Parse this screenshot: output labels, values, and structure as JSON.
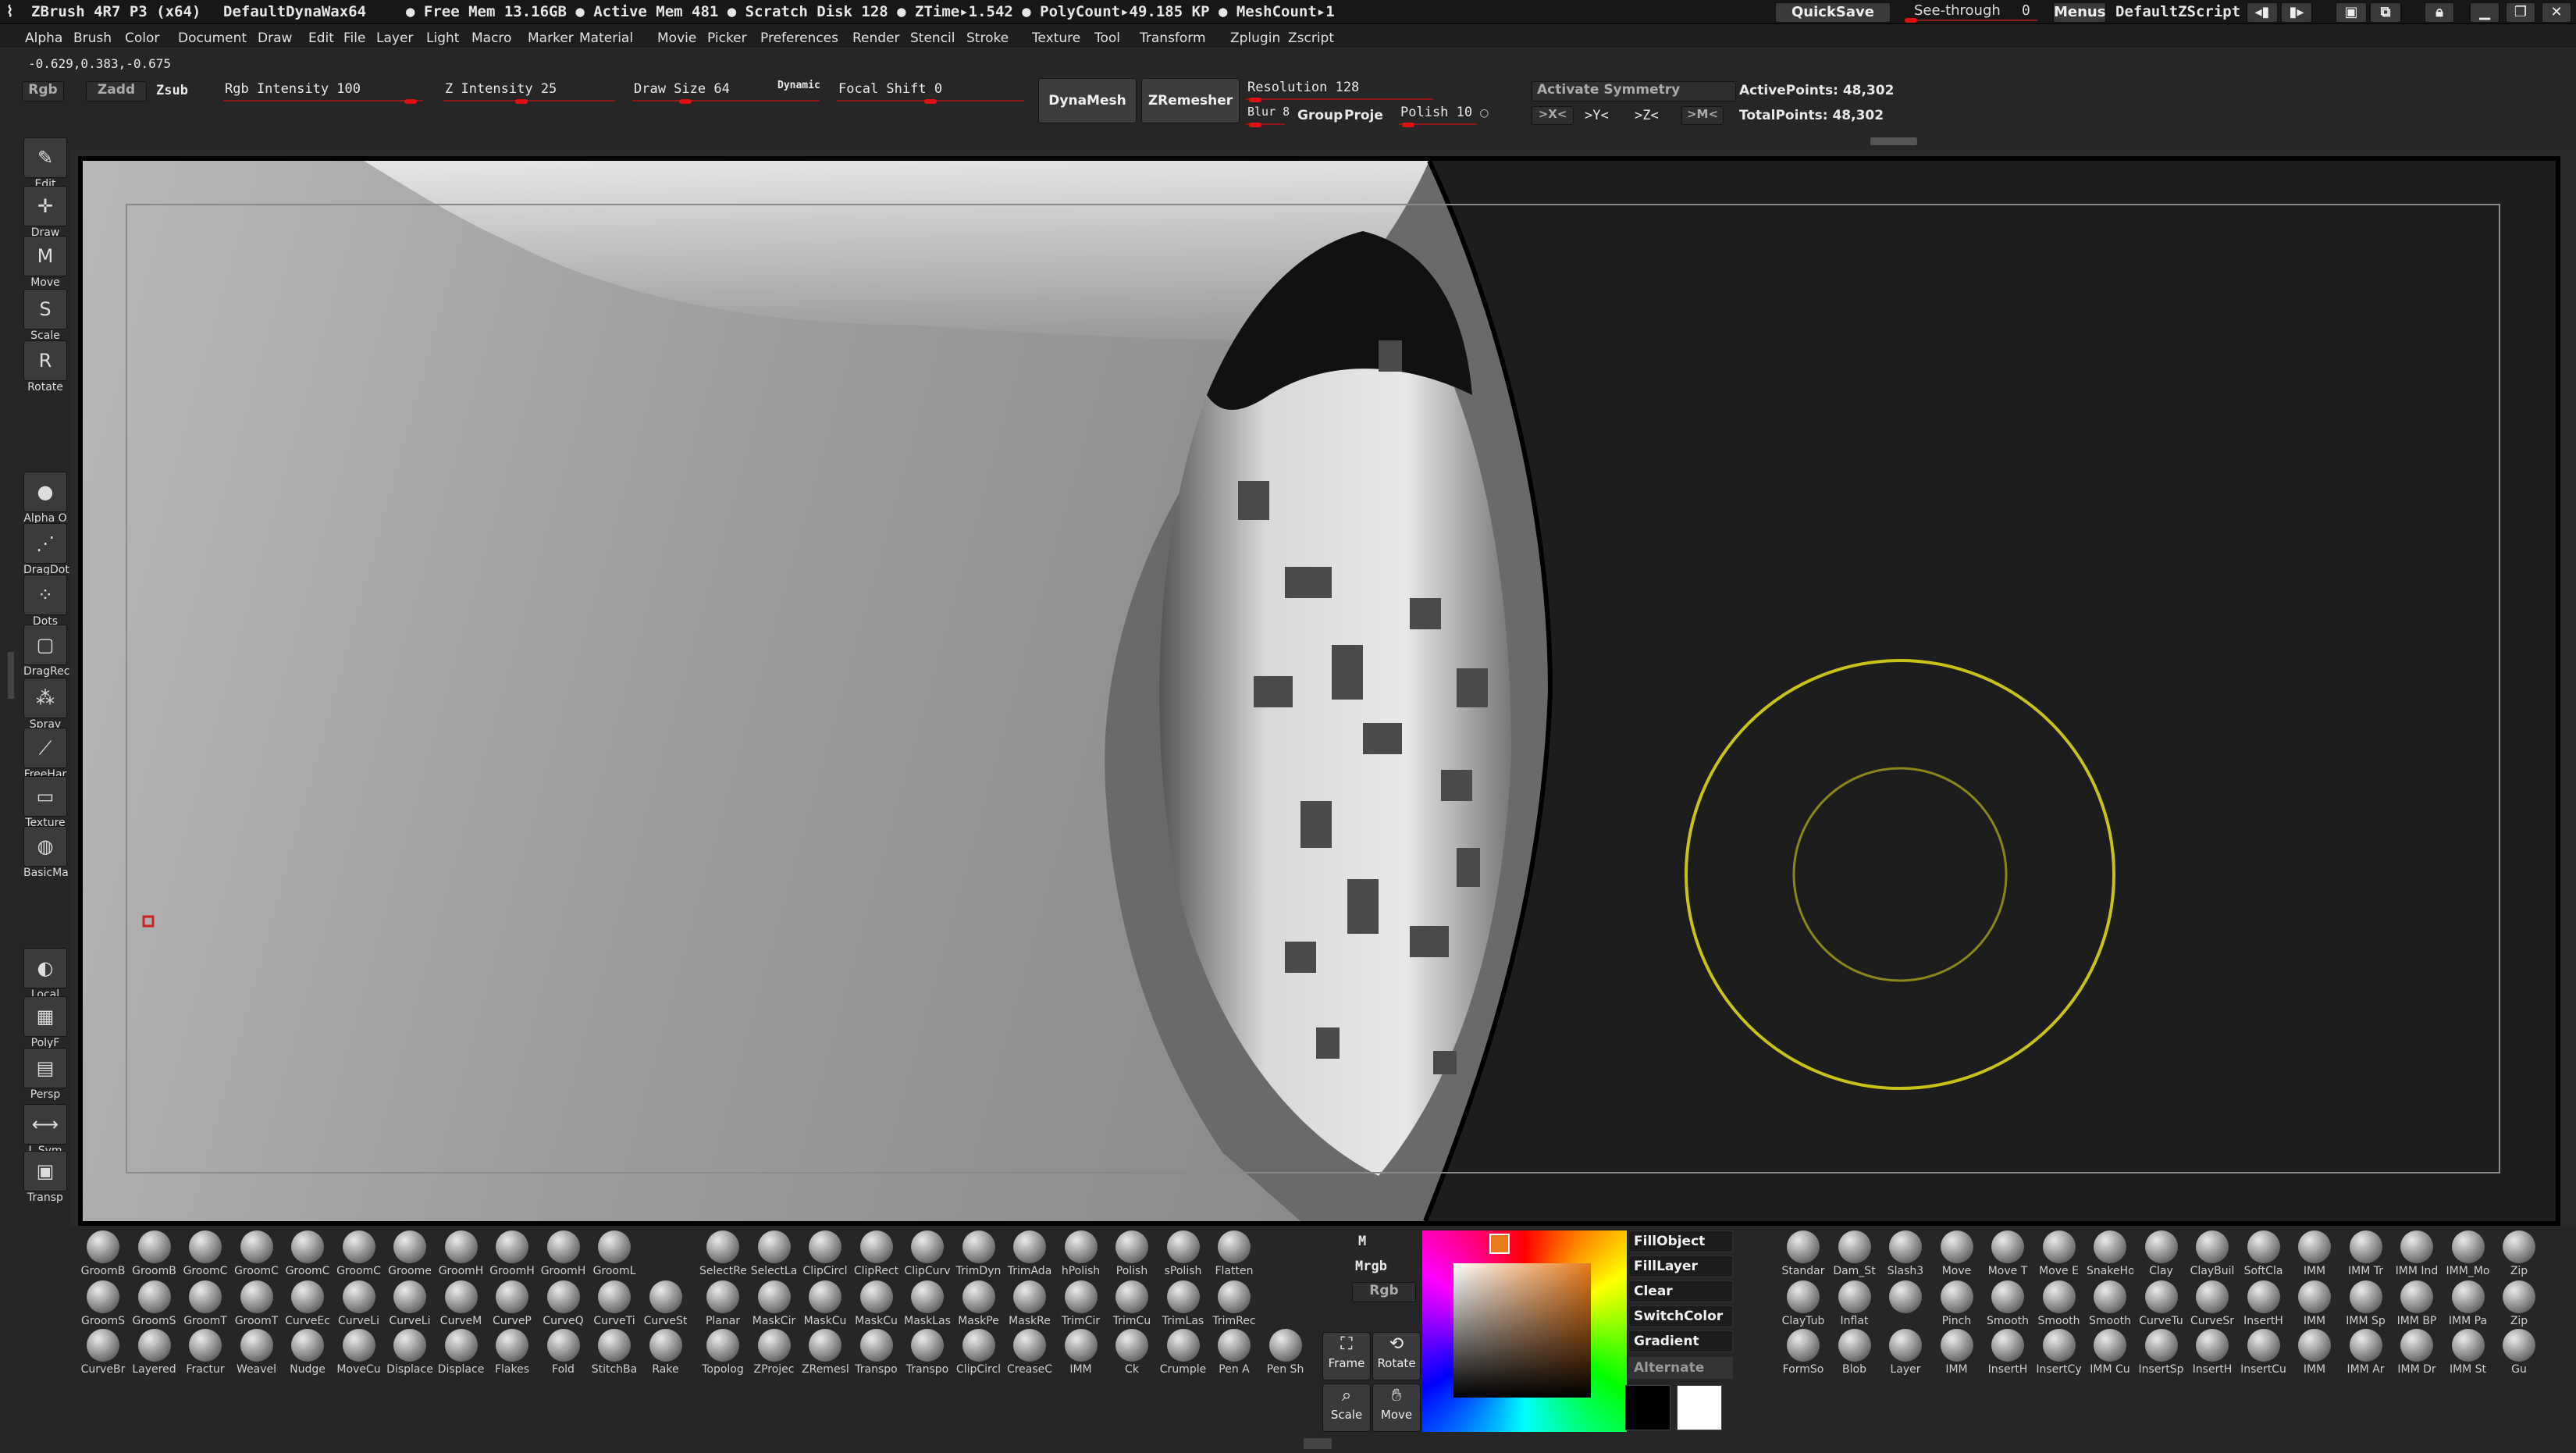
{
  "titlebar": {
    "app": "ZBrush 4R7 P3 (x64)",
    "project": "DefaultDynaWax64",
    "stats": "● Free Mem 13.16GB ● Active Mem 481 ● Scratch Disk 128 ● ZTime▸1.542 ● PolyCount▸49.185 KP ● MeshCount▸1",
    "quicksave": "QuickSave",
    "seethrough": "See-through",
    "seethrough_val": "0",
    "menus": "Menus",
    "script": "DefaultZScript"
  },
  "menubar": [
    "Alpha",
    "Brush",
    "Color",
    "Document",
    "Draw",
    "Edit",
    "File",
    "Layer",
    "Light",
    "Macro",
    "Marker",
    "Material",
    "Movie",
    "Picker",
    "Preferences",
    "Render",
    "Stencil",
    "Stroke",
    "Texture",
    "Tool",
    "Transform",
    "Zplugin",
    "Zscript"
  ],
  "shelf": {
    "coords": "-0.629,0.383,-0.675",
    "rgb": "Rgb",
    "zadd": "Zadd",
    "zsub": "Zsub",
    "rgb_intensity": "Rgb Intensity 100",
    "z_intensity": "Z Intensity 25",
    "draw_size": "Draw Size 64",
    "dynamic": "Dynamic",
    "focal_shift": "Focal Shift 0",
    "dynamesh": "DynaMesh",
    "zremesher": "ZRemesher",
    "resolution": "Resolution 128",
    "blur": "Blur 8",
    "group": "Group",
    "project": "Proje",
    "polish": "Polish 10",
    "activate_symmetry": "Activate Symmetry",
    "x": ">X<",
    "y": ">Y<",
    "z": ">Z<",
    "m": ">M<",
    "active_points": "ActivePoints: 48,302",
    "total_points": "TotalPoints: 48,302"
  },
  "lefttools": [
    {
      "label": "Edit",
      "icon": "edit-icon"
    },
    {
      "label": "Draw",
      "icon": "draw-icon"
    },
    {
      "label": "Move",
      "icon": "move-icon"
    },
    {
      "label": "Scale",
      "icon": "scale-icon"
    },
    {
      "label": "Rotate",
      "icon": "rotate-icon"
    }
  ],
  "leftlower": [
    {
      "label": "Alpha O",
      "icon": "alpha-icon"
    },
    {
      "label": "DragDot",
      "icon": "dragdot-icon"
    },
    {
      "label": "Dots",
      "icon": "dots-icon"
    },
    {
      "label": "DragRec",
      "icon": "dragrect-icon"
    },
    {
      "label": "Spray",
      "icon": "spray-icon"
    },
    {
      "label": "FreeHar",
      "icon": "freehand-icon"
    },
    {
      "label": "Texture",
      "icon": "texture-icon"
    },
    {
      "label": "BasicMa",
      "icon": "material-icon"
    }
  ],
  "leftnav": [
    {
      "label": "Local",
      "icon": "local-icon"
    },
    {
      "label": "PolyF",
      "icon": "polyframe-icon"
    },
    {
      "label": "Persp",
      "icon": "persp-icon"
    },
    {
      "label": "L.Sym",
      "icon": "lsym-icon"
    },
    {
      "label": "Transp",
      "icon": "transp-icon"
    }
  ],
  "brushes_left": [
    [
      "GroomB",
      "GroomB",
      "GroomC",
      "GroomC",
      "GroomC",
      "GroomC",
      "Groome",
      "GroomH",
      "GroomH",
      "GroomH",
      "GroomL"
    ],
    [
      "GroomS",
      "GroomS",
      "GroomT",
      "GroomT",
      "CurveEc",
      "CurveLi",
      "CurveLi",
      "CurveM",
      "CurveP",
      "CurveQ",
      "CurveTi",
      "CurveSt"
    ],
    [
      "CurveBr",
      "Layered",
      "Fractur",
      "Weavel",
      "Nudge",
      "MoveCu",
      "Displace",
      "Displace",
      "Flakes",
      "Fold",
      "StitchBa",
      "Rake"
    ]
  ],
  "brushes_mid": [
    [
      "SelectRe",
      "SelectLa",
      "ClipCircl",
      "ClipRect",
      "ClipCurv",
      "TrimDyn",
      "TrimAda",
      "hPolish",
      "Polish",
      "sPolish",
      "Flatten"
    ],
    [
      "Planar",
      "MaskCir",
      "MaskCu",
      "MaskCu",
      "MaskLas",
      "MaskPe",
      "MaskRe",
      "TrimCir",
      "TrimCu",
      "TrimLas",
      "TrimRec"
    ],
    [
      "Topolog",
      "ZProjec",
      "ZRemesl",
      "Transpo",
      "Transpo",
      "ClipCircl",
      "CreaseC",
      "IMM",
      "Ck",
      "Crumple",
      "Pen A",
      "Pen Sh"
    ]
  ],
  "brushes_right": [
    [
      "Standar",
      "Dam_St",
      "Slash3",
      "Move",
      "Move T",
      "Move E",
      "SnakeHo",
      "Clay",
      "ClayBuil",
      "SoftCla",
      "IMM",
      "IMM Tr",
      "IMM Ind",
      "IMM_Mo",
      "Zip"
    ],
    [
      "ClayTub",
      "Inflat",
      "",
      "Pinch",
      "Smooth",
      "Smooth",
      "Smooth",
      "CurveTu",
      "CurveSr",
      "InsertH",
      "IMM",
      "IMM Sp",
      "IMM BP",
      "IMM Pa",
      "Zip"
    ],
    [
      "FormSo",
      "Blob",
      "Layer",
      "IMM",
      "InsertH",
      "InsertCy",
      "IMM Cu",
      "InsertSp",
      "InsertH",
      "InsertCu",
      "IMM",
      "IMM Ar",
      "IMM Dr",
      "IMM St",
      "Gu"
    ]
  ],
  "color": {
    "m": "M",
    "mrgb": "Mrgb",
    "rgb": "Rgb",
    "fillobject": "FillObject",
    "filllayer": "FillLayer",
    "clear": "Clear",
    "switchcolor": "SwitchColor",
    "gradient": "Gradient",
    "alternate": "Alternate"
  },
  "nav": {
    "frame": "Frame",
    "rotate": "Rotate",
    "scale": "Scale",
    "move": "Move"
  }
}
